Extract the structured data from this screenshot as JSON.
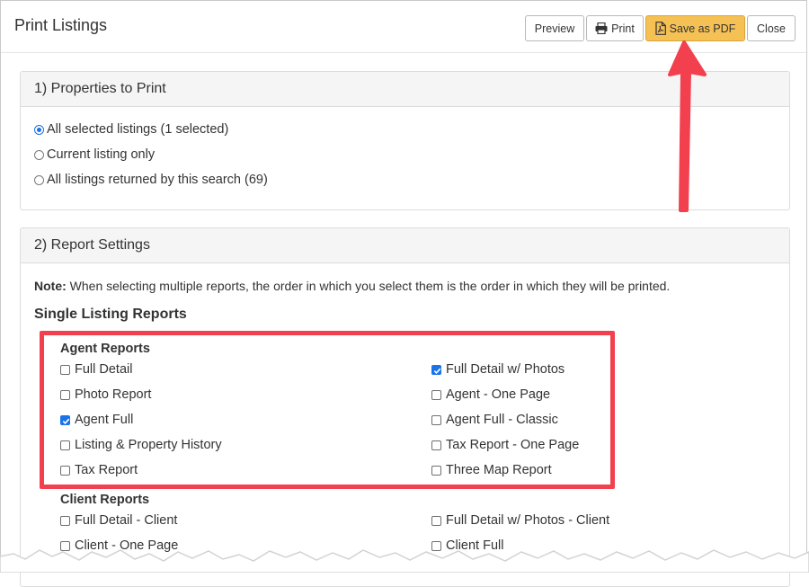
{
  "dialog": {
    "title": "Print Listings",
    "buttons": {
      "preview": "Preview",
      "print": "Print",
      "save_pdf": "Save as PDF",
      "close": "Close"
    }
  },
  "section1": {
    "heading": "1) Properties to Print",
    "options": [
      {
        "label": "All selected listings (1 selected)",
        "selected": true
      },
      {
        "label": "Current listing only",
        "selected": false
      },
      {
        "label": "All listings returned by this search (69)",
        "selected": false
      }
    ]
  },
  "section2": {
    "heading": "2) Report Settings",
    "note_label": "Note:",
    "note_text": " When selecting multiple reports, the order in which you select them is the order in which they will be printed.",
    "single_title": "Single Listing Reports",
    "agent": {
      "title": "Agent Reports",
      "left": [
        {
          "label": "Full Detail",
          "checked": false
        },
        {
          "label": "Photo Report",
          "checked": false
        },
        {
          "label": "Agent Full",
          "checked": true
        },
        {
          "label": "Listing & Property History",
          "checked": false
        },
        {
          "label": "Tax Report",
          "checked": false
        }
      ],
      "right": [
        {
          "label": "Full Detail w/ Photos",
          "checked": true
        },
        {
          "label": "Agent - One Page",
          "checked": false
        },
        {
          "label": "Agent Full - Classic",
          "checked": false
        },
        {
          "label": "Tax Report - One Page",
          "checked": false
        },
        {
          "label": "Three Map Report",
          "checked": false
        }
      ]
    },
    "client": {
      "title": "Client Reports",
      "left": [
        {
          "label": "Full Detail - Client",
          "checked": false
        },
        {
          "label": "Client - One Page",
          "checked": false
        }
      ],
      "right": [
        {
          "label": "Full Detail w/ Photos - Client",
          "checked": false
        },
        {
          "label": "Client Full",
          "checked": false
        }
      ]
    }
  },
  "colors": {
    "accent": "#1a73e8",
    "pdf_button": "#f5c155",
    "annotation": "#f2404f"
  },
  "icons": [
    "printer-icon",
    "pdf-file-icon",
    "annotation-arrow"
  ]
}
